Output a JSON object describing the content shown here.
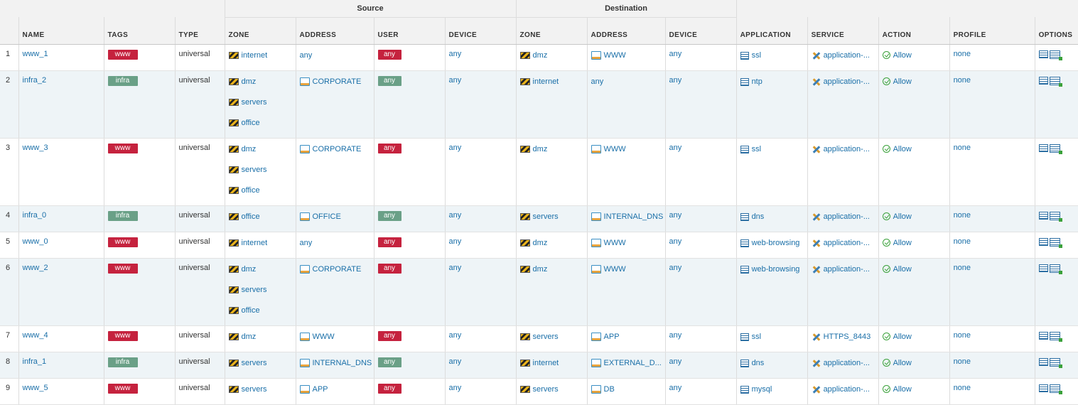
{
  "header": {
    "source_group": "Source",
    "destination_group": "Destination",
    "columns": {
      "name": "NAME",
      "tags": "TAGS",
      "type": "TYPE",
      "src_zone": "ZONE",
      "src_address": "ADDRESS",
      "user": "USER",
      "src_device": "DEVICE",
      "dst_zone": "ZONE",
      "dst_address": "ADDRESS",
      "dst_device": "DEVICE",
      "application": "APPLICATION",
      "service": "SERVICE",
      "action": "ACTION",
      "profile": "PROFILE",
      "options": "OPTIONS"
    }
  },
  "colors": {
    "tag_www": "#c5223e",
    "tag_infra": "#6aa087",
    "link": "#1a6fa8",
    "row_alt": "#eef4f7"
  },
  "rows": [
    {
      "num": "1",
      "name": "www_1",
      "tag": "www",
      "tag_kind": "www",
      "type": "universal",
      "src_zones": [
        "internet"
      ],
      "src_address": {
        "text": "any",
        "icon": false
      },
      "user": "any",
      "user_kind": "www",
      "src_device": "any",
      "dst_zone": "dmz",
      "dst_address": {
        "text": "WWW",
        "icon": true
      },
      "dst_device": "any",
      "application": "ssl",
      "service": "application-...",
      "action": "Allow",
      "profile": "none"
    },
    {
      "num": "2",
      "name": "infra_2",
      "tag": "infra",
      "tag_kind": "infra",
      "type": "universal",
      "src_zones": [
        "dmz",
        "servers",
        "office"
      ],
      "src_address": {
        "text": "CORPORATE",
        "icon": true
      },
      "user": "any",
      "user_kind": "infra",
      "src_device": "any",
      "dst_zone": "internet",
      "dst_address": {
        "text": "any",
        "icon": false
      },
      "dst_device": "any",
      "application": "ntp",
      "service": "application-...",
      "action": "Allow",
      "profile": "none"
    },
    {
      "num": "3",
      "name": "www_3",
      "tag": "www",
      "tag_kind": "www",
      "type": "universal",
      "src_zones": [
        "dmz",
        "servers",
        "office"
      ],
      "src_address": {
        "text": "CORPORATE",
        "icon": true
      },
      "user": "any",
      "user_kind": "www",
      "src_device": "any",
      "dst_zone": "dmz",
      "dst_address": {
        "text": "WWW",
        "icon": true
      },
      "dst_device": "any",
      "application": "ssl",
      "service": "application-...",
      "action": "Allow",
      "profile": "none"
    },
    {
      "num": "4",
      "name": "infra_0",
      "tag": "infra",
      "tag_kind": "infra",
      "type": "universal",
      "src_zones": [
        "office"
      ],
      "src_address": {
        "text": "OFFICE",
        "icon": true
      },
      "user": "any",
      "user_kind": "infra",
      "src_device": "any",
      "dst_zone": "servers",
      "dst_address": {
        "text": "INTERNAL_DNS",
        "icon": true
      },
      "dst_device": "any",
      "application": "dns",
      "service": "application-...",
      "action": "Allow",
      "profile": "none"
    },
    {
      "num": "5",
      "name": "www_0",
      "tag": "www",
      "tag_kind": "www",
      "type": "universal",
      "src_zones": [
        "internet"
      ],
      "src_address": {
        "text": "any",
        "icon": false
      },
      "user": "any",
      "user_kind": "www",
      "src_device": "any",
      "dst_zone": "dmz",
      "dst_address": {
        "text": "WWW",
        "icon": true
      },
      "dst_device": "any",
      "application": "web-browsing",
      "service": "application-...",
      "action": "Allow",
      "profile": "none"
    },
    {
      "num": "6",
      "name": "www_2",
      "tag": "www",
      "tag_kind": "www",
      "type": "universal",
      "src_zones": [
        "dmz",
        "servers",
        "office"
      ],
      "src_address": {
        "text": "CORPORATE",
        "icon": true
      },
      "user": "any",
      "user_kind": "www",
      "src_device": "any",
      "dst_zone": "dmz",
      "dst_address": {
        "text": "WWW",
        "icon": true
      },
      "dst_device": "any",
      "application": "web-browsing",
      "service": "application-...",
      "action": "Allow",
      "profile": "none"
    },
    {
      "num": "7",
      "name": "www_4",
      "tag": "www",
      "tag_kind": "www",
      "type": "universal",
      "src_zones": [
        "dmz"
      ],
      "src_address": {
        "text": "WWW",
        "icon": true
      },
      "user": "any",
      "user_kind": "www",
      "src_device": "any",
      "dst_zone": "servers",
      "dst_address": {
        "text": "APP",
        "icon": true
      },
      "dst_device": "any",
      "application": "ssl",
      "service": "HTTPS_8443",
      "action": "Allow",
      "profile": "none"
    },
    {
      "num": "8",
      "name": "infra_1",
      "tag": "infra",
      "tag_kind": "infra",
      "type": "universal",
      "src_zones": [
        "servers"
      ],
      "src_address": {
        "text": "INTERNAL_DNS",
        "icon": true
      },
      "user": "any",
      "user_kind": "infra",
      "src_device": "any",
      "dst_zone": "internet",
      "dst_address": {
        "text": "EXTERNAL_D...",
        "icon": true
      },
      "dst_device": "any",
      "application": "dns",
      "service": "application-...",
      "action": "Allow",
      "profile": "none"
    },
    {
      "num": "9",
      "name": "www_5",
      "tag": "www",
      "tag_kind": "www",
      "type": "universal",
      "src_zones": [
        "servers"
      ],
      "src_address": {
        "text": "APP",
        "icon": true
      },
      "user": "any",
      "user_kind": "www",
      "src_device": "any",
      "dst_zone": "servers",
      "dst_address": {
        "text": "DB",
        "icon": true
      },
      "dst_device": "any",
      "application": "mysql",
      "service": "application-...",
      "action": "Allow",
      "profile": "none"
    }
  ]
}
